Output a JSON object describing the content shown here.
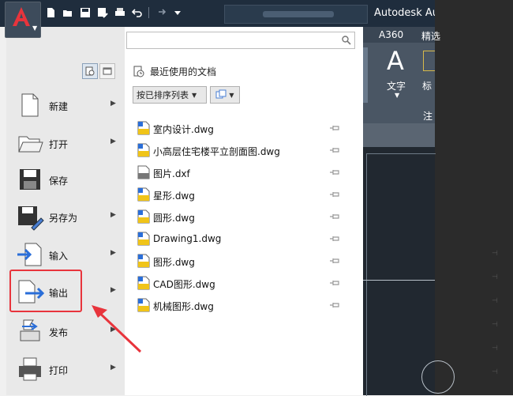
{
  "app": {
    "title": "Autodesk Au",
    "logo_letter": "A",
    "accent": "#e8343c"
  },
  "quick_access_icons": [
    "new-icon",
    "open-icon",
    "save-icon",
    "save-as-icon",
    "print-icon",
    "undo-icon",
    "redo-icon",
    "customize-icon"
  ],
  "ribbon": {
    "tab_a360": "A360",
    "tab_next": "精选",
    "big_button_letter": "A",
    "big_button_label": "文字",
    "second_label": "标",
    "panel_label": "注"
  },
  "app_menu": {
    "commands": [
      {
        "id": "new",
        "label": "新建",
        "icon": "new-doc-icon",
        "has_submenu": true
      },
      {
        "id": "open",
        "label": "打开",
        "icon": "open-folder-icon",
        "has_submenu": true
      },
      {
        "id": "save",
        "label": "保存",
        "icon": "save-disk-icon",
        "has_submenu": false
      },
      {
        "id": "saveas",
        "label": "另存为",
        "icon": "save-as-icon",
        "has_submenu": true
      },
      {
        "id": "import",
        "label": "输入",
        "icon": "import-icon",
        "has_submenu": true
      },
      {
        "id": "export",
        "label": "输出",
        "icon": "export-icon",
        "has_submenu": true
      },
      {
        "id": "publish",
        "label": "发布",
        "icon": "publish-icon",
        "has_submenu": true
      },
      {
        "id": "print",
        "label": "打印",
        "icon": "print-icon",
        "has_submenu": true
      }
    ],
    "highlighted": "export"
  },
  "search": {
    "placeholder": ""
  },
  "recent": {
    "heading": "最近使用的文档",
    "sort_label": "按已排序列表",
    "files": [
      {
        "name": "室内设计.dwg",
        "type": "dwg"
      },
      {
        "name": "小高层住宅楼平立剖面图.dwg",
        "type": "dwg"
      },
      {
        "name": "图片.dxf",
        "type": "dxf"
      },
      {
        "name": "星形.dwg",
        "type": "dwg"
      },
      {
        "name": "圆形.dwg",
        "type": "dwg"
      },
      {
        "name": "Drawing1.dwg",
        "type": "dwg"
      },
      {
        "name": "图形.dwg",
        "type": "dwg"
      },
      {
        "name": "CAD图形.dwg",
        "type": "dwg"
      },
      {
        "name": "机械图形.dwg",
        "type": "dwg"
      }
    ]
  }
}
